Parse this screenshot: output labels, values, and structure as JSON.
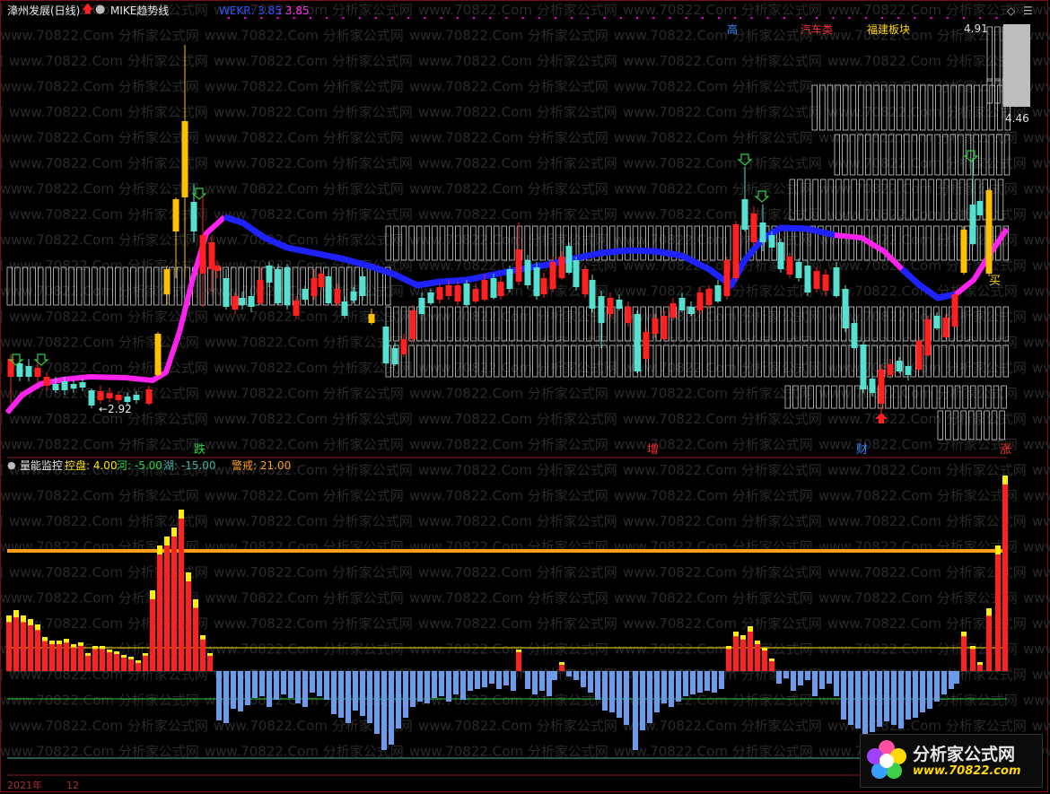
{
  "colors": {
    "background": "#000000",
    "up": "#ff2020",
    "down": "#55e0cf",
    "trend_up": "#ff22ee",
    "trend_down": "#1e22ff",
    "gold": "#ffc000",
    "volume_neg": "#6a9ceb",
    "warning_line": "#ff9f1a",
    "river_line": "#2ecc40",
    "lake_line": "#40b0a0",
    "control_line": "#ffe100"
  },
  "header": {
    "stock_name": "漳州发展(日线)",
    "indicator_name": "MIKE趋势线",
    "wekr_label": "WEKR: 3.85",
    "wekr_value": ": 3.85",
    "tags": [
      {
        "label": "高",
        "color": "#3a8bff"
      },
      {
        "label": "汽车类",
        "color": "#ff3030"
      },
      {
        "label": "福建板块",
        "color": "#ffd700"
      }
    ],
    "right_icons": [
      "diamond-icon",
      "menu-icon"
    ]
  },
  "price_axis": {
    "high_label": "4.91",
    "low_marker": "4.46"
  },
  "annotations": {
    "min_price_label": "←2.92",
    "buy_label": "买",
    "events": [
      {
        "label": "跌",
        "color": "#22dd44"
      },
      {
        "label": "增",
        "color": "#ff3030"
      },
      {
        "label": "财",
        "color": "#3a8bff"
      },
      {
        "label": "涨",
        "color": "#ff3030"
      }
    ]
  },
  "volume_panel": {
    "title": "量能监控",
    "control_label": "控盘: 4.00",
    "river_label": "河: -5.00",
    "lake_label": "湖: -15.00",
    "warning_label": "警戒: 21.00"
  },
  "date_axis": {
    "year_label": "2021年",
    "month_label": "12"
  },
  "watermark": "www.70822.Com 分析家公式网",
  "logo": {
    "brand": "分析家公式网",
    "url": "www.70822.com"
  }
}
